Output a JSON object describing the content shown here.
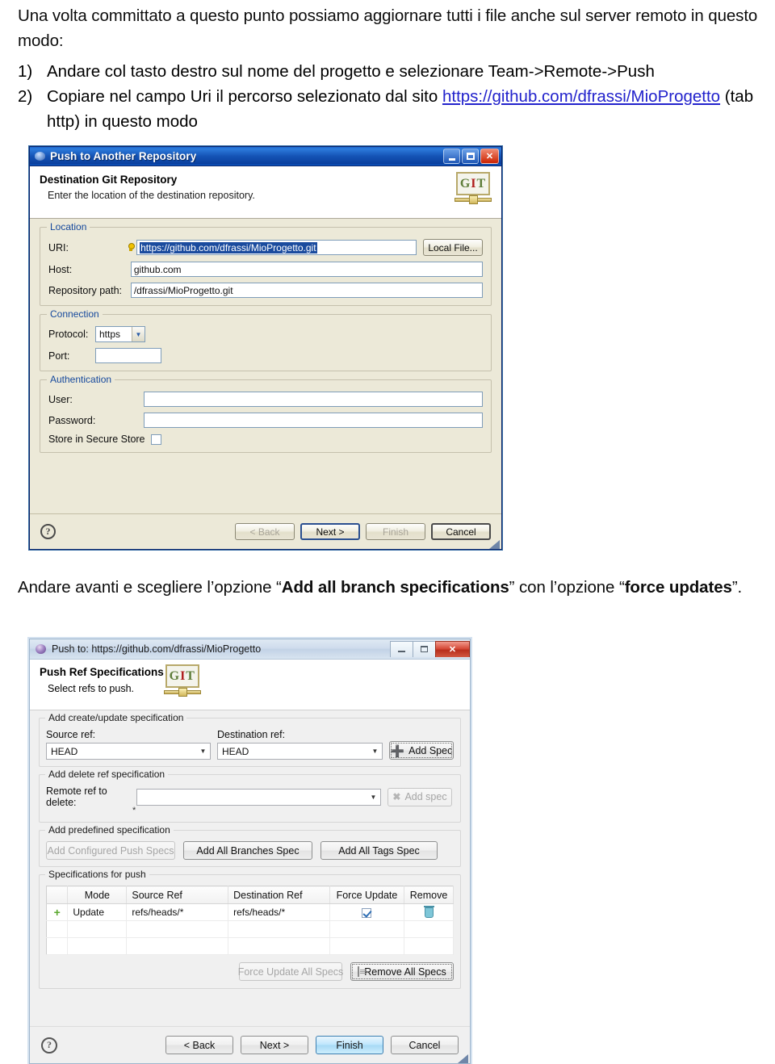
{
  "document": {
    "intro_paragraph": "Una volta committato a questo punto possiamo aggiornare tutti i file anche sul server remoto in questo modo:",
    "steps": [
      {
        "marker": "1)",
        "text": "Andare col tasto destro sul nome del progetto e selezionare Team->Remote->Push"
      },
      {
        "marker": "2)",
        "text_before": "Copiare nel campo Uri il percorso selezionato dal sito ",
        "link": "https://github.com/dfrassi/MioProgetto",
        "text_after": " (tab http) in questo modo"
      }
    ],
    "middle_paragraph": {
      "before": "Andare avanti e scegliere l’opzione “",
      "bold1": "Add all branch specifications",
      "mid": "” con l’opzione “",
      "bold2": "force updates",
      "after": "”."
    }
  },
  "dialog1": {
    "title": "Push to Another Repository",
    "window_buttons": {
      "minimize": "_",
      "maximize": "□",
      "close": "✕"
    },
    "header": {
      "title": "Destination Git Repository",
      "subtitle": "Enter the location of the destination repository.",
      "logo_g": "G",
      "logo_i": "I",
      "logo_t": "T"
    },
    "location": {
      "group_title": "Location",
      "uri_label": "URI:",
      "uri_value": "https://github.com/dfrassi/MioProgetto.git",
      "local_file_button": "Local File...",
      "host_label": "Host:",
      "host_value": "github.com",
      "repo_path_label": "Repository path:",
      "repo_path_value": "/dfrassi/MioProgetto.git"
    },
    "connection": {
      "group_title": "Connection",
      "protocol_label": "Protocol:",
      "protocol_value": "https",
      "port_label": "Port:",
      "port_value": ""
    },
    "authentication": {
      "group_title": "Authentication",
      "user_label": "User:",
      "user_value": "",
      "password_label": "Password:",
      "password_value": "",
      "store_label": "Store in Secure Store"
    },
    "footer": {
      "help": "?",
      "back": "< Back",
      "next": "Next >",
      "finish": "Finish",
      "cancel": "Cancel"
    }
  },
  "dialog2": {
    "title": "Push to: https://github.com/dfrassi/MioProgetto",
    "window_buttons": {
      "minimize": "–",
      "maximize": "□",
      "close": "✕"
    },
    "header": {
      "title": "Push Ref Specifications",
      "subtitle": "Select refs to push.",
      "logo_g": "G",
      "logo_i": "I",
      "logo_t": "T"
    },
    "create_update": {
      "group_title": "Add create/update specification",
      "source_ref_label": "Source ref:",
      "source_ref_value": "HEAD",
      "destination_ref_label": "Destination ref:",
      "destination_ref_value": "HEAD",
      "add_spec_button": "Add Spec"
    },
    "delete_ref": {
      "group_title": "Add delete ref specification",
      "remote_ref_label": "Remote ref to delete:",
      "remote_ref_value": "",
      "remote_ref_hint": "*",
      "add_spec_button": "Add spec"
    },
    "predefined": {
      "group_title": "Add predefined specification",
      "add_configured": "Add Configured Push Specs",
      "add_all_branches": "Add All Branches Spec",
      "add_all_tags": "Add All Tags Spec"
    },
    "specs_for_push": {
      "group_title": "Specifications for push",
      "columns": [
        "",
        "Mode",
        "Source Ref",
        "Destination Ref",
        "Force Update",
        "Remove"
      ],
      "rows": [
        {
          "icon": "+",
          "mode": "Update",
          "source_ref": "refs/heads/*",
          "destination_ref": "refs/heads/*",
          "force_update": true,
          "remove": "trash-icon"
        }
      ],
      "force_update_all": "Force Update All Specs",
      "remove_all": "Remove All Specs"
    },
    "footer": {
      "help": "?",
      "back": "< Back",
      "next": "Next >",
      "finish": "Finish",
      "cancel": "Cancel"
    }
  }
}
